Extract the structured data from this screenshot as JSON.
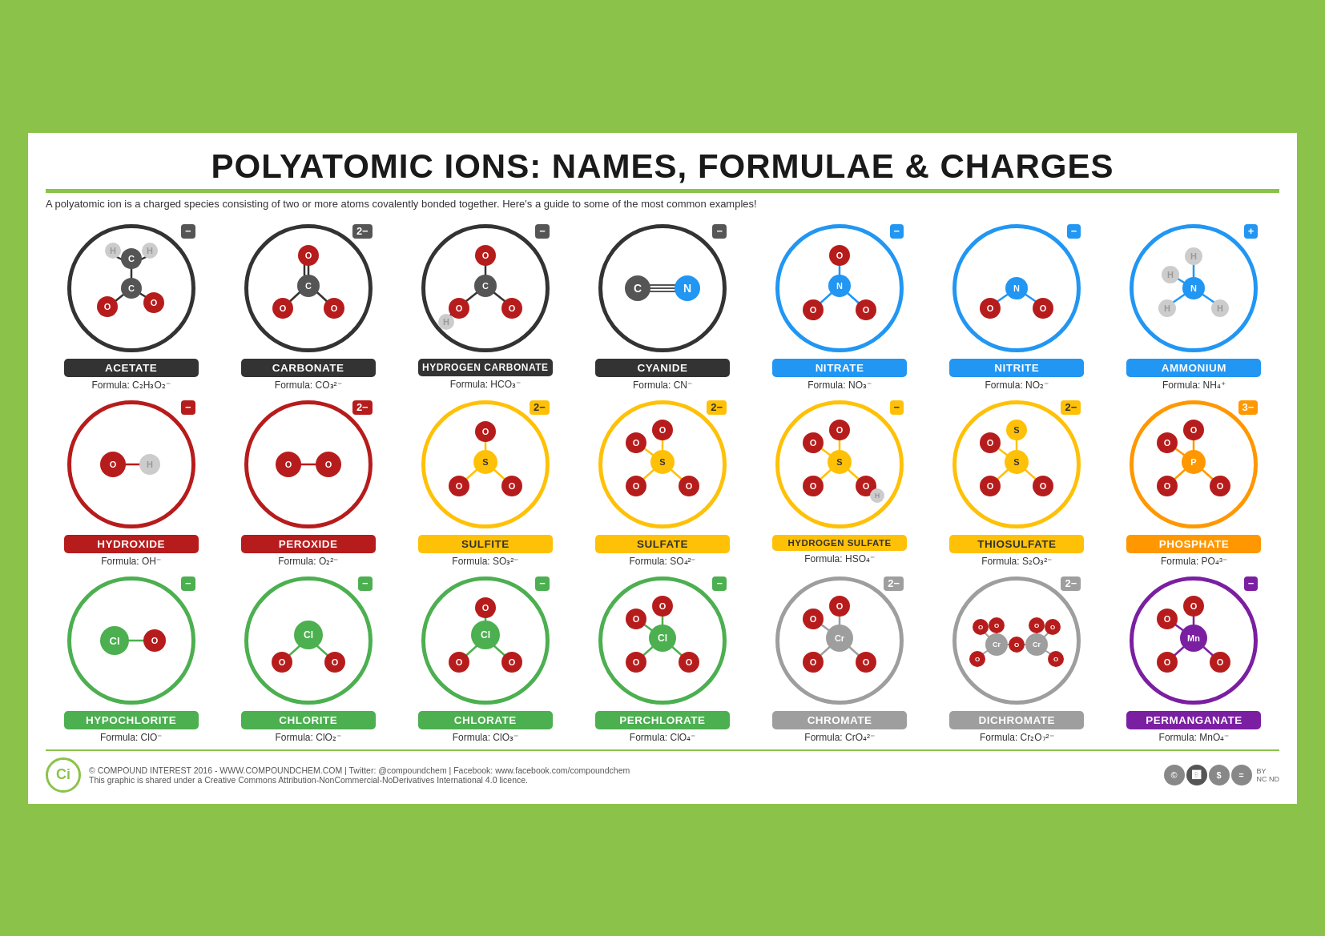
{
  "title": "POLYATOMIC IONS: NAMES, FORMULAE & CHARGES",
  "subtitle": "A polyatomic ion is a charged species consisting of two or more atoms covalently bonded together. Here's a guide to some of the most common examples!",
  "ions": [
    {
      "name": "ACETATE",
      "formula": "Formula: C₂H₃O₂⁻",
      "charge": "−",
      "color": "dark",
      "badge": "dark-badge",
      "atoms": "acetate"
    },
    {
      "name": "CARBONATE",
      "formula": "Formula: CO₃²⁻",
      "charge": "2−",
      "color": "dark",
      "badge": "dark-badge",
      "atoms": "carbonate"
    },
    {
      "name": "HYDROGEN CARBONATE",
      "formula": "Formula: HCO₃⁻",
      "charge": "−",
      "color": "dark",
      "badge": "dark-badge",
      "atoms": "hydrogen-carbonate"
    },
    {
      "name": "CYANIDE",
      "formula": "Formula: CN⁻",
      "charge": "−",
      "color": "dark",
      "badge": "dark-badge",
      "atoms": "cyanide"
    },
    {
      "name": "NITRATE",
      "formula": "Formula: NO₃⁻",
      "charge": "−",
      "color": "blue",
      "badge": "blue-badge",
      "atoms": "nitrate"
    },
    {
      "name": "NITRITE",
      "formula": "Formula: NO₂⁻",
      "charge": "−",
      "color": "blue",
      "badge": "blue-badge",
      "atoms": "nitrite"
    },
    {
      "name": "AMMONIUM",
      "formula": "Formula: NH₄⁺",
      "charge": "+",
      "color": "blue",
      "badge": "blue-badge",
      "atoms": "ammonium"
    },
    {
      "name": "HYDROXIDE",
      "formula": "Formula: OH⁻",
      "charge": "−",
      "color": "red",
      "badge": "red-badge",
      "atoms": "hydroxide"
    },
    {
      "name": "PEROXIDE",
      "formula": "Formula: O₂²⁻",
      "charge": "2−",
      "color": "red",
      "badge": "red-badge",
      "atoms": "peroxide"
    },
    {
      "name": "SULFITE",
      "formula": "Formula: SO₃²⁻",
      "charge": "2−",
      "color": "yellow",
      "badge": "yellow-badge",
      "atoms": "sulfite"
    },
    {
      "name": "SULFATE",
      "formula": "Formula: SO₄²⁻",
      "charge": "2−",
      "color": "yellow",
      "badge": "yellow-badge",
      "atoms": "sulfate"
    },
    {
      "name": "HYDROGEN SULFATE",
      "formula": "Formula: HSO₄⁻",
      "charge": "−",
      "color": "yellow",
      "badge": "yellow-badge",
      "atoms": "hydrogen-sulfate"
    },
    {
      "name": "THIOSULFATE",
      "formula": "Formula: S₂O₃²⁻",
      "charge": "2−",
      "color": "yellow",
      "badge": "yellow-badge",
      "atoms": "thiosulfate"
    },
    {
      "name": "PHOSPHATE",
      "formula": "Formula: PO₄³⁻",
      "charge": "3−",
      "color": "orange",
      "badge": "orange-badge",
      "atoms": "phosphate"
    },
    {
      "name": "HYPOCHLORITE",
      "formula": "Formula: ClO⁻",
      "charge": "−",
      "color": "green",
      "badge": "green-badge",
      "atoms": "hypochlorite"
    },
    {
      "name": "CHLORITE",
      "formula": "Formula: ClO₂⁻",
      "charge": "−",
      "color": "green",
      "badge": "green-badge",
      "atoms": "chlorite"
    },
    {
      "name": "CHLORATE",
      "formula": "Formula: ClO₃⁻",
      "charge": "−",
      "color": "green",
      "badge": "green-badge",
      "atoms": "chlorate"
    },
    {
      "name": "PERCHLORATE",
      "formula": "Formula: ClO₄⁻",
      "charge": "−",
      "color": "green",
      "badge": "green-badge",
      "atoms": "perchlorate"
    },
    {
      "name": "CHROMATE",
      "formula": "Formula: CrO₄²⁻",
      "charge": "2−",
      "color": "gray",
      "badge": "gray-badge",
      "atoms": "chromate"
    },
    {
      "name": "DICHROMATE",
      "formula": "Formula: Cr₂O₇²⁻",
      "charge": "2−",
      "color": "gray",
      "badge": "gray-badge",
      "atoms": "dichromate"
    },
    {
      "name": "PERMANGANATE",
      "formula": "Formula: MnO₄⁻",
      "charge": "−",
      "color": "purple",
      "badge": "purple-badge",
      "atoms": "permanganate"
    }
  ],
  "footer": {
    "logo": "Ci",
    "text1": "© COMPOUND INTEREST 2016 - WWW.COMPOUNDCHEM.COM | Twitter: @compoundchem | Facebook: www.facebook.com/compoundchem",
    "text2": "This graphic is shared under a Creative Commons Attribution-NonCommercial-NoDerivatives International 4.0 licence."
  }
}
